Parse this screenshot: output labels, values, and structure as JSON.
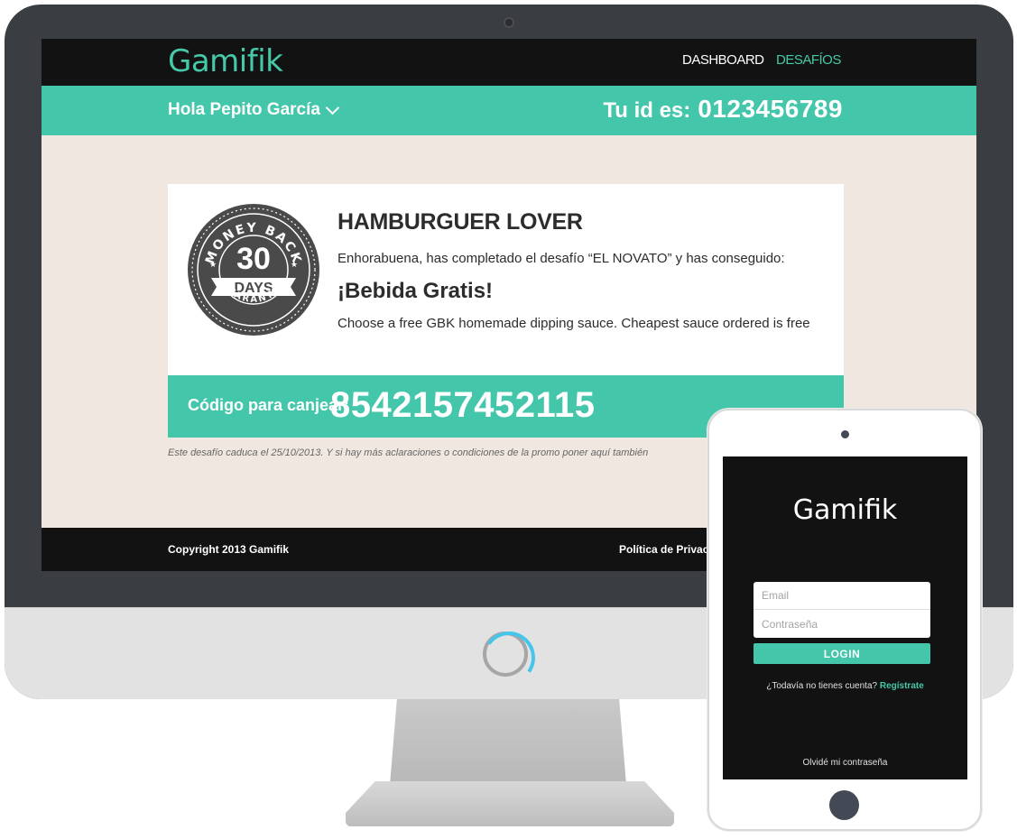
{
  "desktop": {
    "logo": "Gamifik",
    "nav": {
      "dashboard": "DASHBOARD",
      "desafios": "DESAFÍOS"
    },
    "user_greeting": "Hola Pepito García",
    "id_label": "Tu id es:",
    "id_value": "0123456789",
    "badge": {
      "top_text": "MONEY BACK",
      "number": "30",
      "days": "DAYS",
      "bottom_text": "GUARANTEE"
    },
    "challenge": {
      "title": "HAMBURGUER LOVER",
      "message": "Enhorabuena, has completado el desafío “EL NOVATO” y has conseguido:",
      "reward": "¡Bebida Gratis!",
      "description": "Choose a free GBK homemade dipping sauce. Cheapest sauce ordered is free"
    },
    "redeem": {
      "label": "Código para canjear:",
      "code": "8542157452115"
    },
    "expiry_note": "Este desafío caduca el 25/10/2013. Y si hay más aclaraciones o condiciones de la promo poner aquí también",
    "footer": {
      "copyright": "Copyright 2013 Gamifik",
      "privacy": "Política de Privacidad"
    }
  },
  "tablet": {
    "logo": "Gamifik",
    "email_placeholder": "Email",
    "password_placeholder": "Contraseña",
    "login_label": "LOGIN",
    "signup_prompt": "¿Todavía no tienes cuenta?",
    "signup_link": "Regístrate",
    "forgot": "Olvidé mi contraseña"
  },
  "colors": {
    "accent": "#43c6aa",
    "dark": "#121212",
    "page_bg": "#efe7e0",
    "frame": "#3a3d41"
  },
  "icons": [
    "chevron-down-icon",
    "money-back-badge-icon",
    "power-indicator-icon",
    "tablet-home-button"
  ]
}
